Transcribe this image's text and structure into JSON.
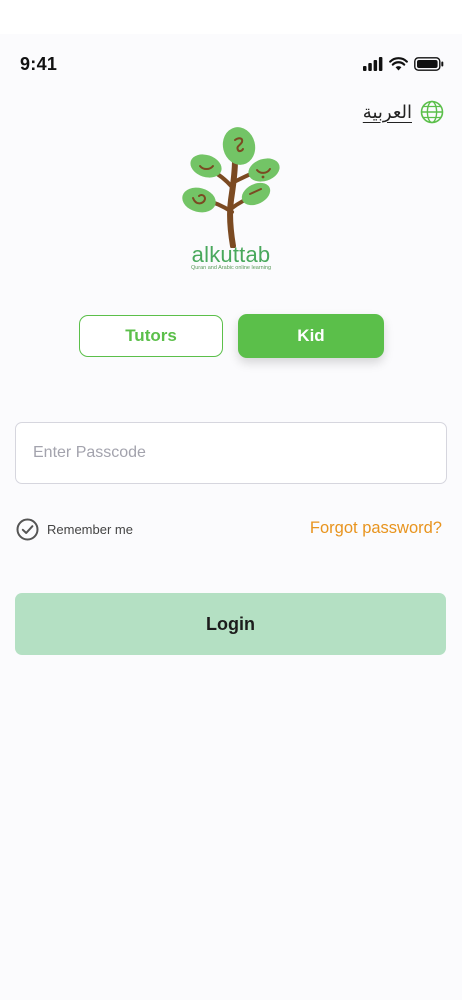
{
  "status_bar": {
    "time": "9:41"
  },
  "language": {
    "label": "العربية"
  },
  "logo": {
    "name": "alkuttab",
    "tagline": "Quran and Arabic online learning"
  },
  "role_toggle": {
    "tutors_label": "Tutors",
    "kid_label": "Kid",
    "selected": "Kid"
  },
  "login_form": {
    "passcode_placeholder": "Enter Passcode",
    "passcode_value": "",
    "remember_label": "Remember me",
    "forgot_label": "Forgot password?",
    "login_label": "Login"
  },
  "colors": {
    "brand_green": "#5bbf4a",
    "login_button": "#b4e0c3",
    "forgot_link": "#e8941e",
    "tree_trunk": "#7b4a22",
    "leaf_green": "#73c466"
  }
}
